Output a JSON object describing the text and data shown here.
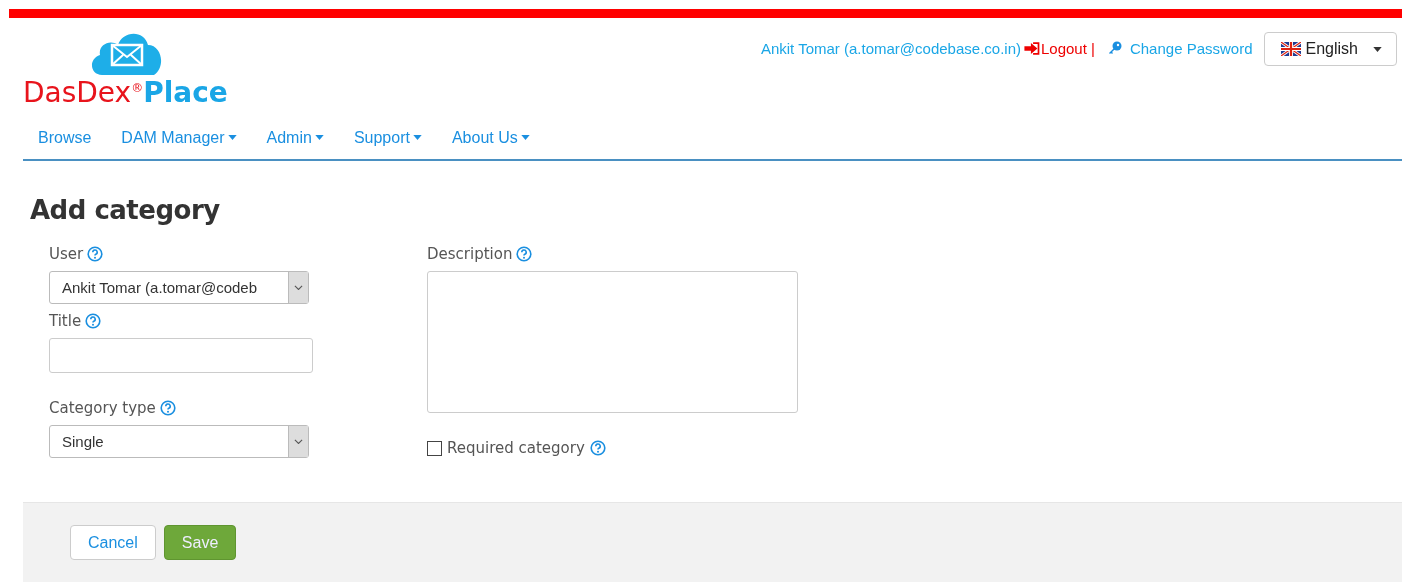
{
  "logo": {
    "brand_first": "DasDex$^{®}$",
    "brand_second": "Place"
  },
  "user_bar": {
    "user": "Ankit Tomar (a.tomar@codebase.co.in)",
    "logout": "Logout |",
    "change_password": "Change Password",
    "language": "English"
  },
  "nav": [
    {
      "label": "Browse",
      "dropdown": false
    },
    {
      "label": "DAM Manager",
      "dropdown": true
    },
    {
      "label": "Admin",
      "dropdown": true
    },
    {
      "label": "Support",
      "dropdown": true
    },
    {
      "label": "About Us",
      "dropdown": true
    }
  ],
  "page_title": "Add category",
  "fields_left": [
    {
      "kind": "select",
      "label": "User",
      "value": "Ankit Tomar (a.tomar@codeb"
    },
    {
      "kind": "text",
      "label": "Title"
    },
    {
      "kind": "select",
      "label": "Category type",
      "value": "Single"
    }
  ],
  "description": {
    "label": "Description"
  },
  "required_category": {
    "label": "Required category",
    "checked": false
  },
  "buttons": [
    {
      "kind": "cancel",
      "label": "Cancel"
    },
    {
      "kind": "save",
      "label": "Save"
    }
  ]
}
